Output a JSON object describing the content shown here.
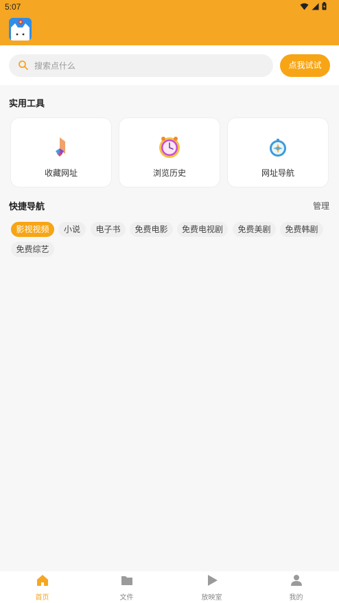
{
  "status_bar": {
    "time": "5:07"
  },
  "search": {
    "placeholder": "搜索点什么",
    "button_label": "点我试试"
  },
  "tools_section": {
    "title": "实用工具",
    "items": [
      {
        "label": "收藏网址",
        "icon": "bookmark-icon"
      },
      {
        "label": "浏览历史",
        "icon": "history-clock-icon"
      },
      {
        "label": "网址导航",
        "icon": "compass-icon"
      }
    ]
  },
  "quick_nav": {
    "title": "快捷导航",
    "manage_label": "管理",
    "chips": [
      "影视视频",
      "小说",
      "电子书",
      "免费电影",
      "免费电视剧",
      "免费美剧",
      "免费韩剧",
      "免费综艺"
    ],
    "active_chip": "影视视频"
  },
  "bottom_nav": {
    "items": [
      {
        "label": "首页",
        "icon": "home-icon"
      },
      {
        "label": "文件",
        "icon": "folder-icon"
      },
      {
        "label": "放映室",
        "icon": "play-icon"
      },
      {
        "label": "我的",
        "icon": "user-icon"
      }
    ],
    "active": "首页"
  },
  "colors": {
    "accent": "#f5a623",
    "button": "#f7a515",
    "background": "#f7f7f7"
  }
}
